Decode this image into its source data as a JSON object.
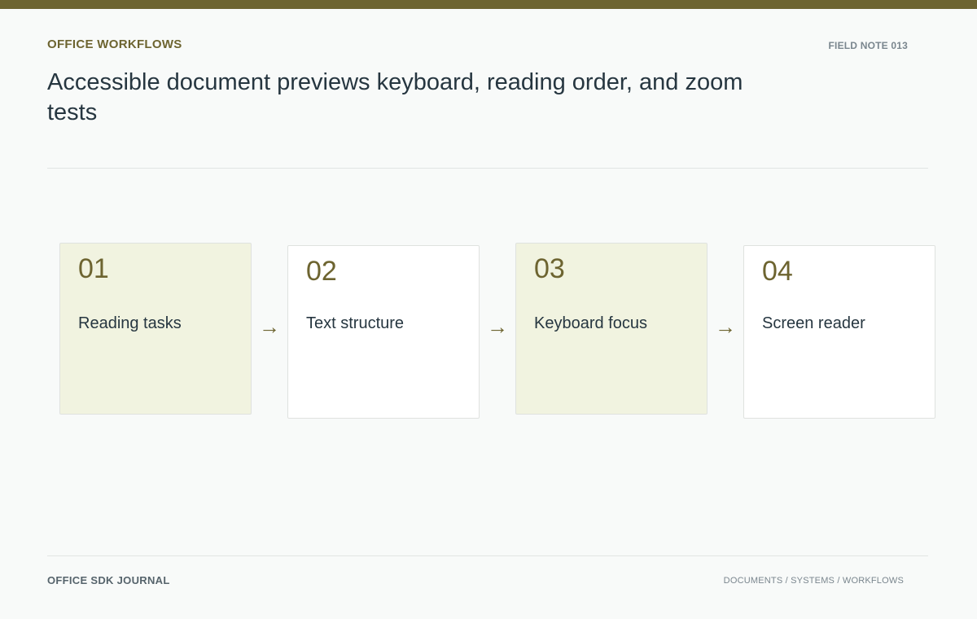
{
  "header": {
    "eyebrow": "OFFICE WORKFLOWS",
    "field_note": "FIELD NOTE 013",
    "title": "Accessible document previews keyboard, reading order, and zoom tests"
  },
  "steps": [
    {
      "number": "01",
      "label": "Reading tasks"
    },
    {
      "number": "02",
      "label": "Text structure"
    },
    {
      "number": "03",
      "label": "Keyboard focus"
    },
    {
      "number": "04",
      "label": "Screen reader"
    }
  ],
  "arrow_glyph": "→",
  "footer": {
    "left": "OFFICE SDK JOURNAL",
    "right": "DOCUMENTS / SYSTEMS / WORKFLOWS"
  },
  "colors": {
    "accent": "#6d6430",
    "shaded_card": "#f1f3e0",
    "plain_card": "#ffffff",
    "text": "#263640"
  }
}
